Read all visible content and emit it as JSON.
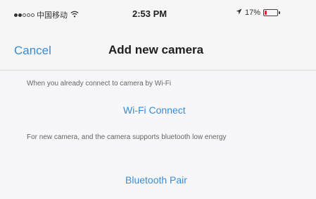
{
  "status_bar": {
    "signal": {
      "full_dots": 2,
      "empty_dots": 3
    },
    "carrier": "中国移动",
    "wifi_icon": "wifi-icon",
    "time": "2:53 PM",
    "location_icon": "location-arrow-icon",
    "battery_percent": "17%",
    "battery_level": 0.17,
    "battery_color": "#e0223a"
  },
  "nav": {
    "cancel_label": "Cancel",
    "title": "Add new camera",
    "accent_color": "#3a8bd3"
  },
  "wifi_section": {
    "description": "When you already connect to camera by Wi-Fi",
    "action_label": "Wi-Fi Connect"
  },
  "bluetooth_section": {
    "description": "For new camera, and the camera supports bluetooth low energy",
    "action_label": "Bluetooth Pair"
  }
}
